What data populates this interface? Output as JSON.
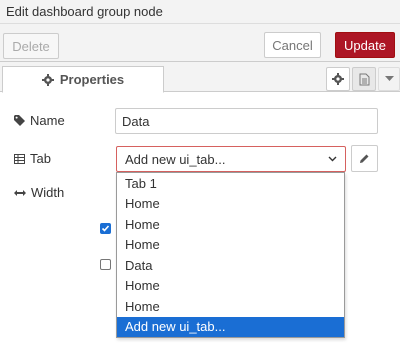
{
  "window": {
    "title": "Edit dashboard group node"
  },
  "toolbar": {
    "delete_label": "Delete",
    "cancel_label": "Cancel",
    "update_label": "Update"
  },
  "tabs": {
    "properties_label": "Properties"
  },
  "form": {
    "name": {
      "label": "Name",
      "value": "Data"
    },
    "tab": {
      "label": "Tab",
      "selected": "Add new ui_tab...",
      "options": [
        "Tab 1",
        "Home",
        "Home",
        "Home",
        "Data",
        "Home",
        "Home",
        "Add new ui_tab..."
      ],
      "highlighted_option": "Add new ui_tab..."
    },
    "width": {
      "label": "Width"
    },
    "checkboxes": [
      {
        "checked": true
      },
      {
        "checked": false
      }
    ]
  },
  "icons": {
    "name": "tag-icon",
    "tab": "table-icon",
    "width": "arrows-horizontal-icon",
    "properties": "gear-icon",
    "settings_tab": "gear-icon",
    "description_tab": "document-icon",
    "more": "caret-down-icon",
    "edit": "pencil-icon"
  },
  "colors": {
    "update_button": "#ad1625",
    "select_border_error": "#d6615f",
    "dropdown_highlight": "#1a6ed4"
  }
}
